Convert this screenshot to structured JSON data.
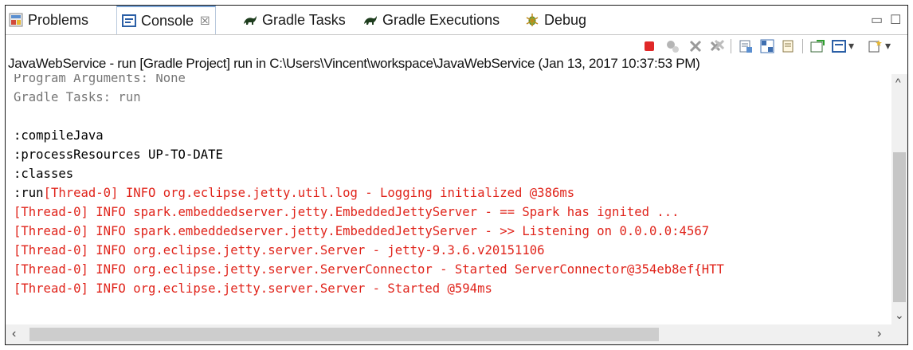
{
  "tabs": [
    {
      "label": "Problems",
      "icon": "problems-icon"
    },
    {
      "label": "Console",
      "icon": "console-icon",
      "active": true
    },
    {
      "label": "Gradle Tasks",
      "icon": "gradle-icon"
    },
    {
      "label": "Gradle Executions",
      "icon": "gradle-icon"
    },
    {
      "label": "Debug",
      "icon": "debug-icon"
    }
  ],
  "console_close": "☒",
  "window_controls": {
    "minimize": "▭",
    "maximize": "☐"
  },
  "toolbar_icons": [
    "terminate-icon",
    "remove-launch-icon",
    "remove-all-launches-icon",
    "clear-console-icon",
    "scroll-lock-icon",
    "word-wrap-icon",
    "pin-console-icon",
    "display-selected-console-icon",
    "open-console-icon"
  ],
  "launch_info": "JavaWebService - run [Gradle Project] run in C:\\Users\\Vincent\\workspace\\JavaWebService (Jan 13, 2017 10:37:53 PM)",
  "console_lines": [
    {
      "text": "Program Arguments: None",
      "color": "gray"
    },
    {
      "text": "Gradle Tasks: run",
      "color": "gray"
    },
    {
      "text": "",
      "color": "black"
    },
    {
      "text": ":compileJava",
      "color": "black"
    },
    {
      "text": ":processResources UP-TO-DATE",
      "color": "black"
    },
    {
      "text": ":classes",
      "color": "black"
    },
    {
      "text": ":run",
      "color": "black",
      "rest": "[Thread-0] INFO org.eclipse.jetty.util.log - Logging initialized @386ms"
    },
    {
      "text": "[Thread-0] INFO spark.embeddedserver.jetty.EmbeddedJettyServer - == Spark has ignited ...",
      "color": "red"
    },
    {
      "text": "[Thread-0] INFO spark.embeddedserver.jetty.EmbeddedJettyServer - >> Listening on 0.0.0.0:4567",
      "color": "red"
    },
    {
      "text": "[Thread-0] INFO org.eclipse.jetty.server.Server - jetty-9.3.6.v20151106",
      "color": "red"
    },
    {
      "text": "[Thread-0] INFO org.eclipse.jetty.server.ServerConnector - Started ServerConnector@354eb8ef{HTT",
      "color": "red"
    },
    {
      "text": "[Thread-0] INFO org.eclipse.jetty.server.Server - Started @594ms",
      "color": "red"
    }
  ],
  "colors": {
    "stderr": "#e0241b",
    "info": "#777777",
    "stdout": "#000000",
    "active_tab": "#7aa4d6"
  }
}
